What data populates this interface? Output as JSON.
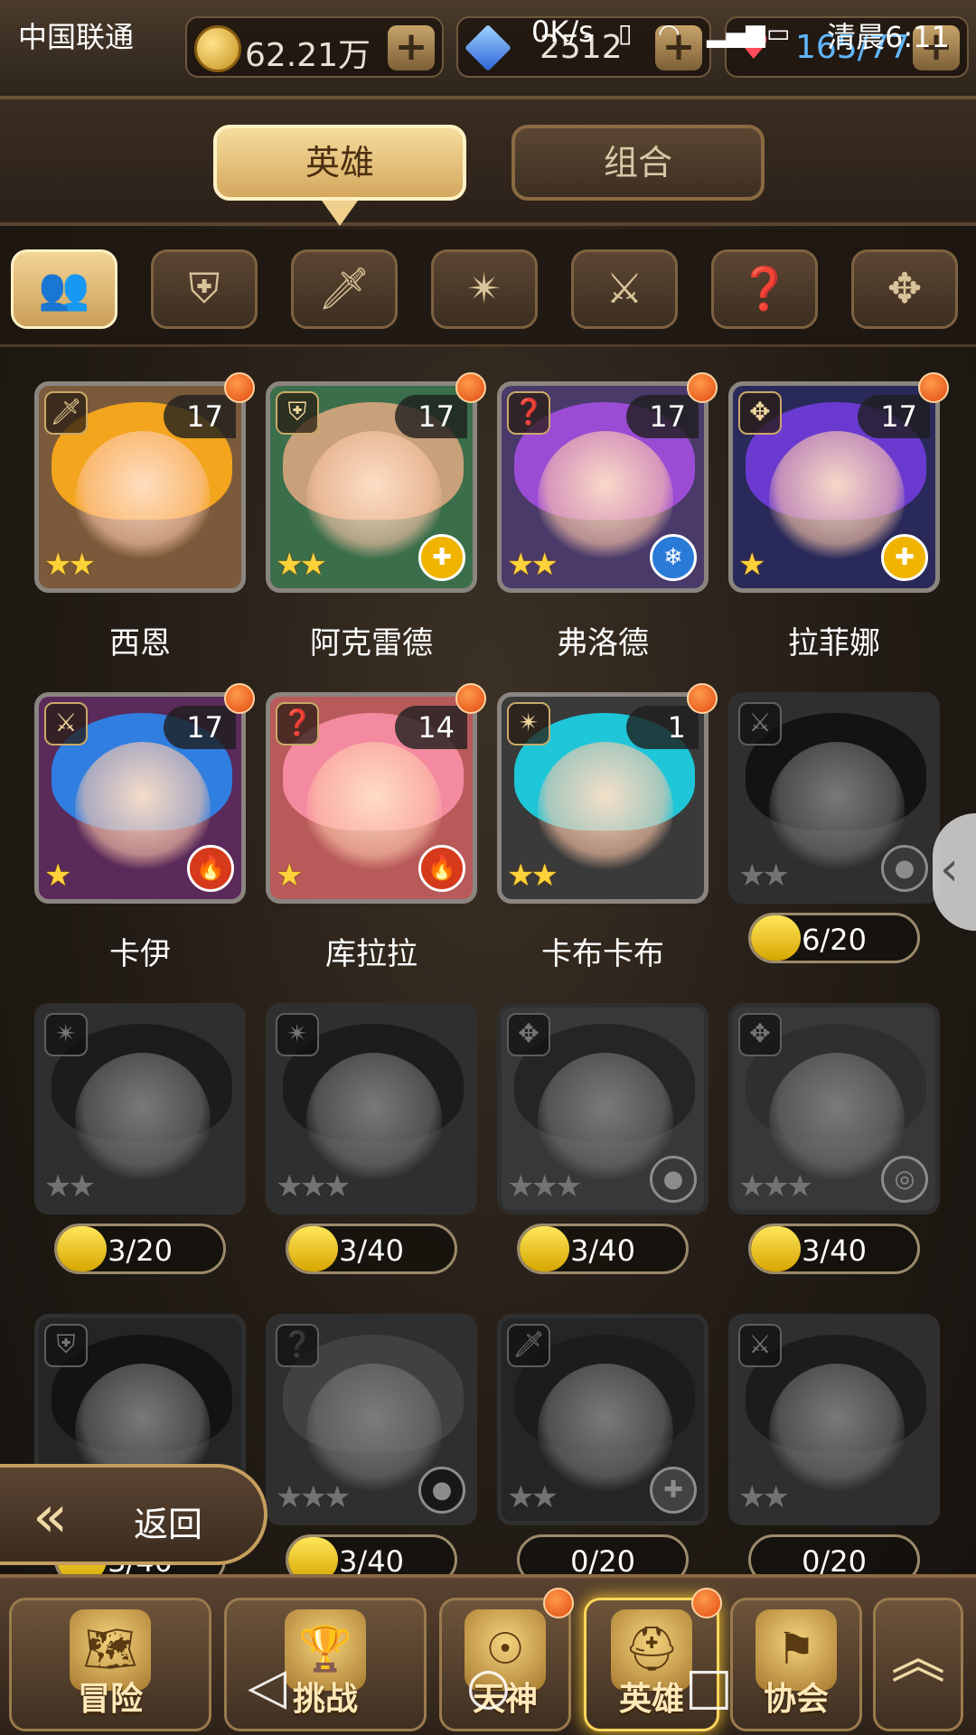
{
  "status_bar": {
    "carrier": "中国联通",
    "net_speed": "0K/s",
    "time": "清晨6:11"
  },
  "resources": {
    "gold": "62.21万",
    "gems": "2512",
    "stamina": "165/77"
  },
  "tabs": [
    {
      "label": "英雄",
      "active": true
    },
    {
      "label": "组合",
      "active": false
    }
  ],
  "filters": [
    {
      "icon": "all-heroes-icon",
      "glyph": "👥",
      "active": true
    },
    {
      "icon": "shield-class-icon",
      "glyph": "⛨",
      "active": false
    },
    {
      "icon": "sword-class-icon",
      "glyph": "🗡",
      "active": false
    },
    {
      "icon": "shuriken-class-icon",
      "glyph": "✴",
      "active": false
    },
    {
      "icon": "bow-class-icon",
      "glyph": "⚔",
      "active": false
    },
    {
      "icon": "support-class-icon",
      "glyph": "❓",
      "active": false
    },
    {
      "icon": "cross-class-icon",
      "glyph": "✥",
      "active": false
    }
  ],
  "heroes": [
    {
      "name": "西恩",
      "level": "17",
      "stars": "★★",
      "class_icon": "sword-class-icon",
      "class_glyph": "🗡",
      "element": "",
      "element_glyph": "",
      "hair": "#f2a51d",
      "bg": "#7a5a3a",
      "new": true
    },
    {
      "name": "阿克雷德",
      "level": "17",
      "stars": "★★",
      "class_icon": "shield-class-icon",
      "class_glyph": "⛨",
      "element": "holy-element-icon",
      "element_glyph": "✚",
      "elem_color": "#f0b400",
      "hair": "#c8a07a",
      "bg": "#3b6e4a",
      "new": true
    },
    {
      "name": "弗洛德",
      "level": "17",
      "stars": "★★",
      "class_icon": "support-class-icon",
      "class_glyph": "❓",
      "element": "water-element-icon",
      "element_glyph": "❄",
      "elem_color": "#2a7ad8",
      "hair": "#9b4cd4",
      "bg": "#4a3a6a",
      "new": true
    },
    {
      "name": "拉菲娜",
      "level": "17",
      "stars": "★",
      "class_icon": "cross-class-icon",
      "class_glyph": "✥",
      "element": "holy-element-icon",
      "element_glyph": "✚",
      "elem_color": "#f0b400",
      "hair": "#6a3ad0",
      "bg": "#2a2a5a",
      "new": true
    },
    {
      "name": "卡伊",
      "level": "17",
      "stars": "★",
      "class_icon": "bow-class-icon",
      "class_glyph": "⚔",
      "element": "fire-element-icon",
      "element_glyph": "🔥",
      "elem_color": "#d63a1a",
      "hair": "#2f7ee0",
      "bg": "#5a2a5a",
      "new": true
    },
    {
      "name": "库拉拉",
      "level": "14",
      "stars": "★",
      "class_icon": "support-class-icon",
      "class_glyph": "❓",
      "element": "fire-element-icon",
      "element_glyph": "🔥",
      "elem_color": "#d63a1a",
      "hair": "#f48aa0",
      "bg": "#b85a5a",
      "new": true
    },
    {
      "name": "卡布卡布",
      "level": "1",
      "stars": "★★",
      "class_icon": "shuriken-class-icon",
      "class_glyph": "✴",
      "element": "",
      "element_glyph": "",
      "hair": "#1fc6d8",
      "bg": "#3a3a3a",
      "new": true
    },
    {
      "name": "",
      "shards": "6/20",
      "shard_progress": 0.3,
      "stars": "★★",
      "class_icon": "bow-class-icon",
      "class_glyph": "⚔",
      "element": "earth-element-icon",
      "element_glyph": "●",
      "elem_color": "#3a7a3a",
      "hair": "#222",
      "bg": "#555",
      "locked": true
    },
    {
      "name": "",
      "shards": "3/20",
      "shard_progress": 0.15,
      "stars": "★★",
      "class_icon": "shuriken-class-icon",
      "class_glyph": "✴",
      "element": "",
      "element_glyph": "",
      "hair": "#333",
      "bg": "#555",
      "locked": true
    },
    {
      "name": "",
      "shards": "3/40",
      "shard_progress": 0.075,
      "stars": "★★★",
      "class_icon": "shuriken-class-icon",
      "class_glyph": "✴",
      "element": "",
      "element_glyph": "",
      "hair": "#333",
      "bg": "#555",
      "locked": true
    },
    {
      "name": "",
      "shards": "3/40",
      "shard_progress": 0.075,
      "stars": "★★★",
      "class_icon": "cross-class-icon",
      "class_glyph": "✥",
      "element": "earth-element-icon",
      "element_glyph": "●",
      "elem_color": "#3a7a3a",
      "hair": "#444",
      "bg": "#666",
      "locked": true
    },
    {
      "name": "",
      "shards": "3/40",
      "shard_progress": 0.075,
      "stars": "★★★",
      "class_icon": "cross-class-icon",
      "class_glyph": "✥",
      "element": "wind-element-icon",
      "element_glyph": "◎",
      "elem_color": "#1a8a8a",
      "hair": "#555",
      "bg": "#666",
      "locked": true
    },
    {
      "name": "",
      "shards": "3/40",
      "shard_progress": 0.075,
      "stars": "★★★",
      "class_icon": "shield-class-icon",
      "class_glyph": "⛨",
      "element": "",
      "element_glyph": "",
      "hair": "#222",
      "bg": "#444",
      "locked": true
    },
    {
      "name": "",
      "shards": "3/40",
      "shard_progress": 0.075,
      "stars": "★★★",
      "class_icon": "support-class-icon",
      "class_glyph": "❓",
      "element": "dark-element-icon",
      "element_glyph": "●",
      "elem_color": "#5a1a5a",
      "hair": "#777",
      "bg": "#555",
      "locked": true
    },
    {
      "name": "",
      "shards": "0/20",
      "shard_progress": 0,
      "stars": "★★",
      "class_icon": "sword-class-icon",
      "class_glyph": "🗡",
      "element": "holy-element-icon",
      "element_glyph": "✚",
      "elem_color": "#8a7a3a",
      "hair": "#333",
      "bg": "#444",
      "locked": true
    },
    {
      "name": "",
      "shards": "0/20",
      "shard_progress": 0,
      "stars": "★★",
      "class_icon": "bow-class-icon",
      "class_glyph": "⚔",
      "element": "",
      "element_glyph": "",
      "hair": "#333",
      "bg": "#555",
      "locked": true
    }
  ],
  "back_button": {
    "label": "返回",
    "icon": "chevron-left-icon"
  },
  "bottom_nav": [
    {
      "label": "冒险",
      "icon": "map-scroll-icon",
      "glyph": "🗺",
      "active": false,
      "dot": false
    },
    {
      "label": "挑战",
      "icon": "trophy-icon",
      "glyph": "🏆",
      "active": false,
      "dot": false
    },
    {
      "label": "天神",
      "icon": "god-emblem-icon",
      "glyph": "☉",
      "active": false,
      "dot": true
    },
    {
      "label": "英雄",
      "icon": "helmet-icon",
      "glyph": "⛑",
      "active": true,
      "dot": true
    },
    {
      "label": "协会",
      "icon": "guild-banner-icon",
      "glyph": "⚑",
      "active": false,
      "dot": false
    }
  ],
  "expand_icon": "double-chevron-up-icon",
  "softkeys": [
    {
      "icon": "back-triangle-icon",
      "glyph": "◁"
    },
    {
      "icon": "home-circle-icon",
      "glyph": "○"
    },
    {
      "icon": "recents-square-icon",
      "glyph": "□"
    }
  ],
  "colors": {
    "accent_gold": "#f3d596",
    "notification_orange": "#e14b12",
    "frame_brown": "#3b2c20"
  }
}
